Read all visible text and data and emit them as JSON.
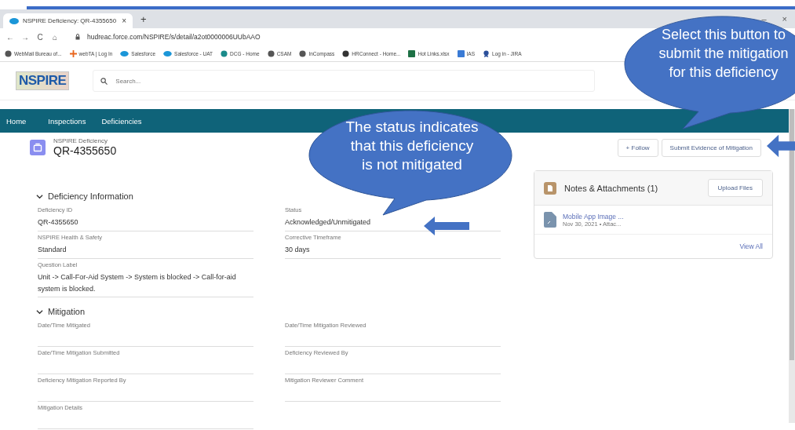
{
  "browser": {
    "tab": {
      "title": "NSPIRE Deficiency: QR-4355650",
      "close": "×",
      "selected": true
    },
    "new_tab": "+",
    "window_controls": [
      "–",
      "×"
    ],
    "nav_buttons": [
      "←",
      "→",
      "C",
      "⌂"
    ],
    "url": "hudreac.force.com/NSPIRE/s/detail/a2ot0000006UUbAAO",
    "bookmarks": [
      {
        "label": "WebMail Bureau of...",
        "kind": "globe"
      },
      {
        "label": "webTA | Log In",
        "kind": "cross"
      },
      {
        "label": "Salesforce",
        "kind": "cloud"
      },
      {
        "label": "Salesforce - UAT",
        "kind": "cloud"
      },
      {
        "label": "DCG - Home",
        "kind": "teal"
      },
      {
        "label": "CSAM",
        "kind": "globe"
      },
      {
        "label": "InCompass",
        "kind": "globe"
      },
      {
        "label": "HRConnect - Home...",
        "kind": "dark"
      },
      {
        "label": "Hot Links.xlsx",
        "kind": "excel"
      },
      {
        "label": "IAS",
        "kind": "doc"
      },
      {
        "label": "Log in - JIRA",
        "kind": "ribbon"
      }
    ]
  },
  "app": {
    "logo": "NSPIRE",
    "search": {
      "placeholder": "Search..."
    },
    "nav": [
      {
        "label": "Home",
        "selected": false
      },
      {
        "label": "Inspections",
        "selected": false
      },
      {
        "label": "Deficiencies",
        "selected": false
      }
    ]
  },
  "record": {
    "type": "NSPIRE Deficiency",
    "name": "QR-4355650",
    "actions": [
      "+ Follow",
      "Submit Evidence of Mitigation"
    ]
  },
  "sections": [
    {
      "title": "Deficiency Information",
      "expanded": true,
      "rows": [
        [
          {
            "label": "Deficiency ID",
            "value": "QR-4355650"
          },
          {
            "label": "Status",
            "value": "Acknowledged/Unmitigated"
          }
        ],
        [
          {
            "label": "NSPIRE Health & Safety",
            "value": "Standard"
          },
          {
            "label": "Corrective Timeframe",
            "value": "30 days"
          }
        ],
        [
          {
            "label": "Question Label",
            "value": "Unit -> Call-For-Aid System -> System is blocked -> Call-for-aid system is blocked."
          },
          null
        ]
      ]
    },
    {
      "title": "Mitigation",
      "expanded": true,
      "rows": [
        [
          {
            "label": "Date/Time Mitigated"
          },
          {
            "label": "Date/Time Mitigation Reviewed"
          }
        ],
        [
          {
            "label": "Date/Time Mitigation Submitted"
          },
          {
            "label": "Deficiency Reviewed By"
          }
        ],
        [
          {
            "label": "Deficiency Mitigation Reported By"
          },
          {
            "label": "Mitigation Reviewer Comment"
          }
        ],
        [
          {
            "label": "Mitigation Details"
          },
          null
        ]
      ]
    }
  ],
  "notes": {
    "title": "Notes & Attachments (1)",
    "upload": "Upload Files",
    "files": [
      {
        "name": "Mobile App Image ...",
        "meta": "Nov 30, 2021 • Attac..."
      }
    ],
    "view_all": "View All"
  },
  "callouts": [
    {
      "text": "The status indicates that this deficiency is not mitigated"
    },
    {
      "text": "Select this button to submit the mitigation for this deficiency"
    }
  ]
}
